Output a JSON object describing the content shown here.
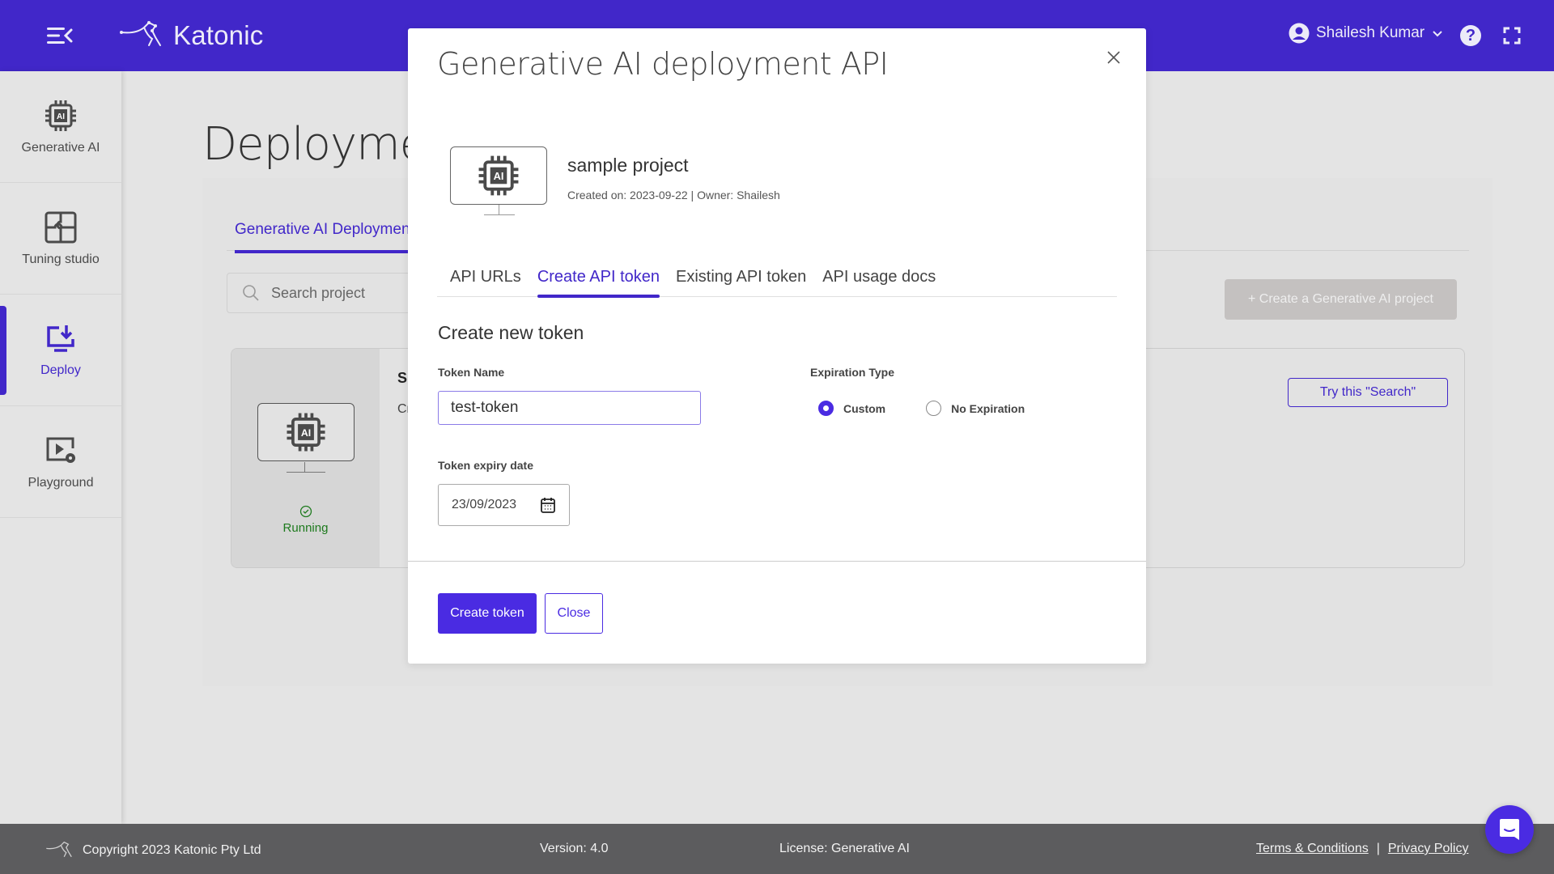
{
  "header": {
    "brand": "Katonic",
    "user_name": "Shailesh Kumar",
    "colors": {
      "primary": "#4127c9",
      "accent": "#4a2be2"
    }
  },
  "sidebar": {
    "items": [
      {
        "label": "Generative AI",
        "icon": "ai-chip-icon",
        "active": false
      },
      {
        "label": "Tuning studio",
        "icon": "puzzle-icon",
        "active": false
      },
      {
        "label": "Deploy",
        "icon": "deploy-monitor-icon",
        "active": true
      },
      {
        "label": "Playground",
        "icon": "playground-icon",
        "active": false
      }
    ]
  },
  "main": {
    "page_title": "Deployments",
    "tab_label": "Generative AI Deployments",
    "search_placeholder": "Search project",
    "create_project_label": "+ Create a Generative AI project",
    "card": {
      "status": "Running",
      "title_partial": "S",
      "meta_partial": "Cr",
      "try_search_label": "Try this \"Search\""
    }
  },
  "modal": {
    "title": "Generative AI deployment API",
    "project": {
      "name": "sample project",
      "meta": "Created on: 2023-09-22 | Owner: Shailesh"
    },
    "tabs": [
      {
        "label": "API URLs",
        "active": false
      },
      {
        "label": "Create API token",
        "active": true
      },
      {
        "label": "Existing API token",
        "active": false
      },
      {
        "label": "API usage docs",
        "active": false
      }
    ],
    "section_title": "Create new token",
    "token_name_label": "Token Name",
    "token_name_value": "test-token",
    "expiration_type_label": "Expiration Type",
    "expiration_options": [
      {
        "label": "Custom",
        "checked": true
      },
      {
        "label": "No Expiration",
        "checked": false
      }
    ],
    "expiry_date_label": "Token expiry date",
    "expiry_date_value": "23/09/2023",
    "create_button": "Create token",
    "close_button": "Close"
  },
  "footer": {
    "copyright": "Copyright 2023 Katonic Pty Ltd",
    "version": "Version: 4.0",
    "license": "License: Generative AI",
    "terms": "Terms & Conditions",
    "separator": "|",
    "privacy": "Privacy Policy"
  }
}
